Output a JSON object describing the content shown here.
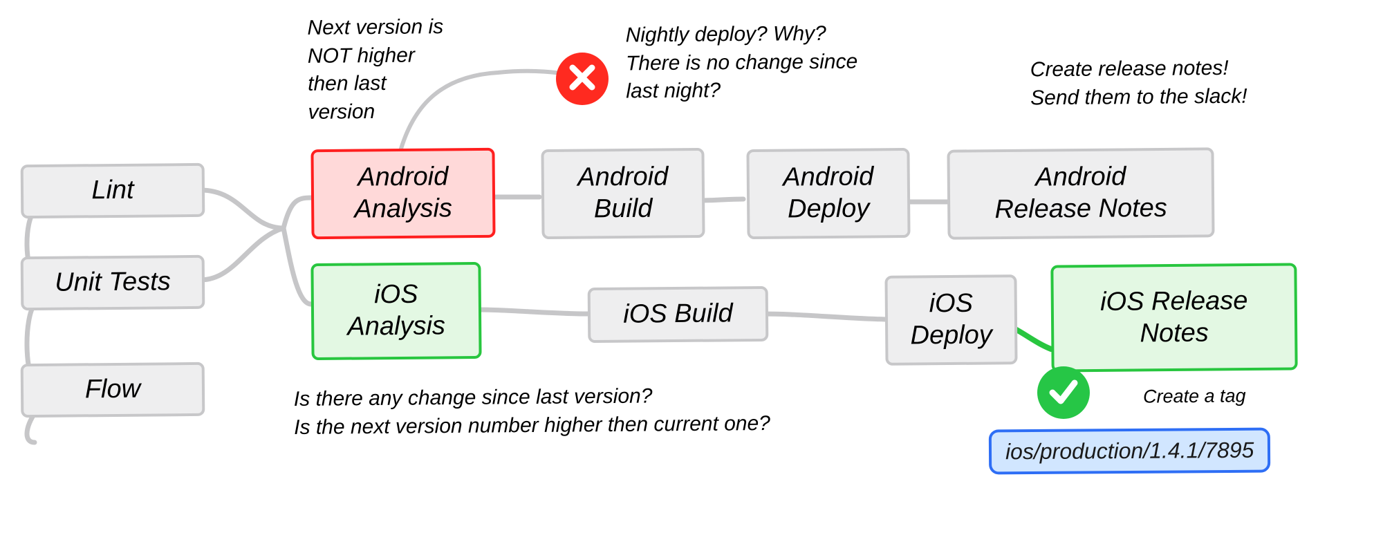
{
  "nodes": {
    "lint": {
      "label": "Lint"
    },
    "unit_tests": {
      "label": "Unit Tests"
    },
    "flow": {
      "label": "Flow"
    },
    "android_analysis": {
      "label": "Android\nAnalysis"
    },
    "android_build": {
      "label": "Android\nBuild"
    },
    "android_deploy": {
      "label": "Android\nDeploy"
    },
    "android_release": {
      "label": "Android\nRelease Notes"
    },
    "ios_analysis": {
      "label": "iOS\nAnalysis"
    },
    "ios_build": {
      "label": "iOS Build"
    },
    "ios_deploy": {
      "label": "iOS\nDeploy"
    },
    "ios_release": {
      "label": "iOS Release\nNotes"
    }
  },
  "notes": {
    "version_fail": "Next version is\nNOT higher\nthen last\nversion",
    "nightly": "Nightly deploy? Why?\nThere is no change since\nlast night?",
    "release_slack": "Create release notes!\nSend them to the slack!",
    "analysis_q": "Is there any change since last version?\nIs the next version number higher then current one?",
    "create_tag": "Create a tag"
  },
  "tag": {
    "label": "ios/production/1.4.1/7895"
  },
  "icons": {
    "fail": "cross-icon",
    "ok": "check-icon"
  },
  "colors": {
    "red": "#ff1f1f",
    "green": "#28c63f",
    "blue": "#2e6ef5",
    "grey": "#c7c7c9"
  }
}
